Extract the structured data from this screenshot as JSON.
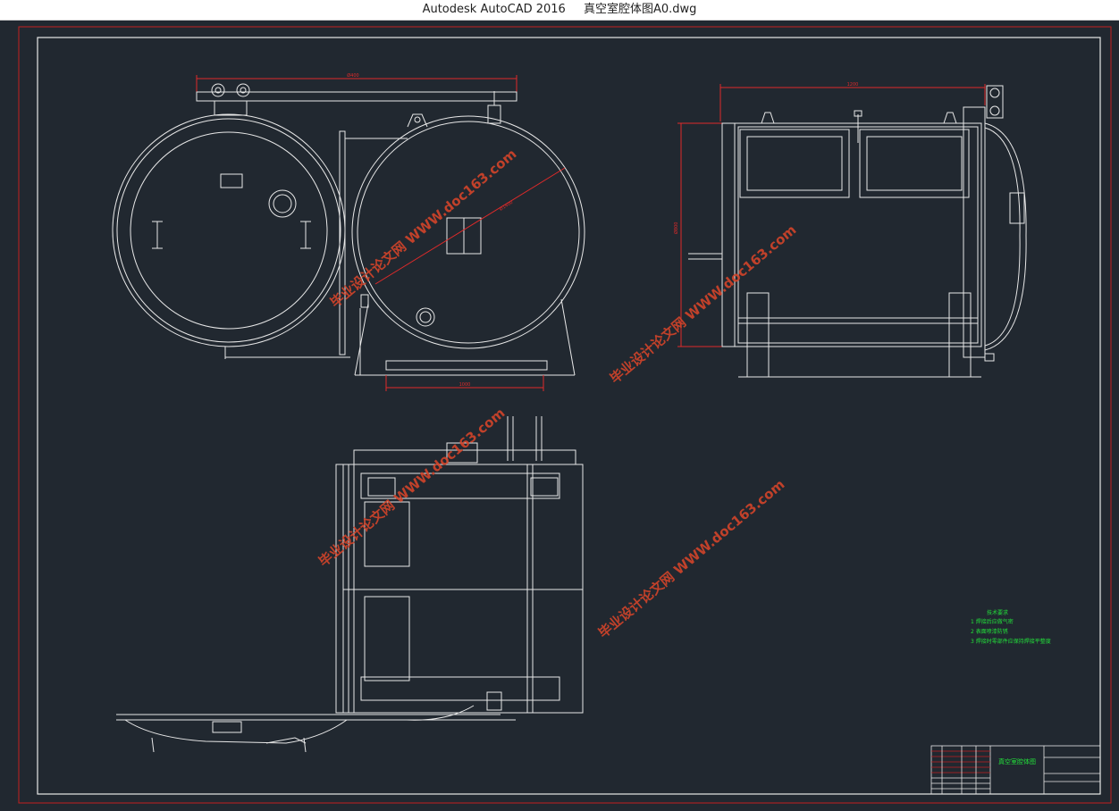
{
  "window": {
    "app_title": "Autodesk AutoCAD 2016",
    "file_name": "真空室腔体图A0.dwg"
  },
  "drawing": {
    "dim_top_left": "Ø400",
    "dim_diag": "Ø1400",
    "dim_bottom": "1000",
    "dim_side_top": "1200",
    "dim_side_vertical": "Ø800",
    "watermark_text": "毕业设计论文网 WWW.doc163.com",
    "notes_title": "技术要求",
    "notes": [
      "1 焊接后应做气密",
      "2 表面喷漆防锈",
      "3 焊接时零部件应保持焊接平整度"
    ],
    "title_block_name": "真空室腔体图",
    "colors": {
      "background": "#212830",
      "line": "#e8e8e8",
      "frame": "#c21f1f",
      "dimension": "#e02a2a",
      "notes": "#22e03a",
      "watermark": "#d4442a"
    }
  }
}
